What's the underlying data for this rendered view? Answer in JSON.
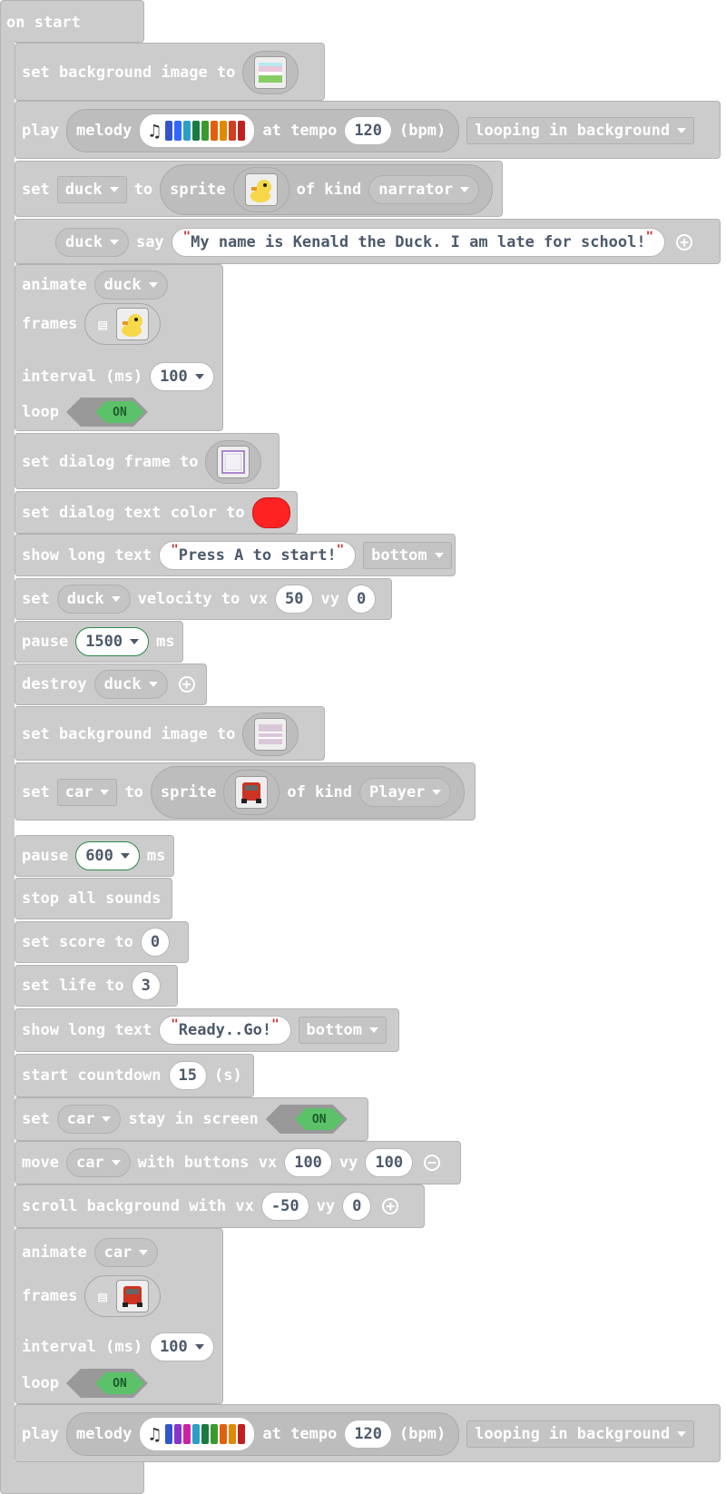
{
  "hat": {
    "label": "on start"
  },
  "blocks": {
    "b1": {
      "t1": "set background image to"
    },
    "b2": {
      "t1": "play",
      "t2": "melody",
      "t3": "at tempo",
      "tempo": "120",
      "t4": "(bpm)",
      "mode": "looping in background",
      "melody_colors": [
        "#3355cc",
        "#3366ff",
        "#2aa0c8",
        "#1a7a40",
        "#3a9a30",
        "#e06010",
        "#e08a00",
        "#d04020",
        "#c02020"
      ]
    },
    "b3": {
      "t1": "set",
      "var": "duck",
      "t2": "to",
      "t3": "sprite",
      "t4": "of kind",
      "kind": "narrator"
    },
    "b4": {
      "var": "duck",
      "t1": "say",
      "text": "My name is Kenald the Duck. I am late for school!"
    },
    "b5": {
      "t1": "animate",
      "var": "duck",
      "t2": "frames",
      "t3": "interval (ms)",
      "interval": "100",
      "t4": "loop",
      "toggle": "ON"
    },
    "b6": {
      "t1": "set dialog frame to"
    },
    "b7": {
      "t1": "set dialog text color to",
      "color": "#ff2222"
    },
    "b8": {
      "t1": "show long text",
      "text": "Press A to start!",
      "pos": "bottom"
    },
    "b9": {
      "t1": "set",
      "var": "duck",
      "t2": "velocity to vx",
      "vx": "50",
      "t3": "vy",
      "vy": "0"
    },
    "b10": {
      "t1": "pause",
      "ms_val": "1500",
      "t2": "ms"
    },
    "b11": {
      "t1": "destroy",
      "var": "duck"
    },
    "b12": {
      "t1": "set background image to"
    },
    "b13": {
      "t1": "set",
      "var": "car",
      "t2": "to",
      "t3": "sprite",
      "t4": "of kind",
      "kind": "Player"
    },
    "b14": {
      "t1": "pause",
      "ms_val": "600",
      "t2": "ms"
    },
    "b15": {
      "t1": "stop all sounds"
    },
    "b16": {
      "t1": "set score to",
      "val": "0"
    },
    "b17": {
      "t1": "set life to",
      "val": "3"
    },
    "b18": {
      "t1": "show long text",
      "text": "Ready..Go!",
      "pos": "bottom"
    },
    "b19": {
      "t1": "start countdown",
      "val": "15",
      "t2": "(s)"
    },
    "b20": {
      "t1": "set",
      "var": "car",
      "t2": "stay in screen",
      "toggle": "ON"
    },
    "b21": {
      "t1": "move",
      "var": "car",
      "t2": "with buttons vx",
      "vx": "100",
      "t3": "vy",
      "vy": "100"
    },
    "b22": {
      "t1": "scroll background with vx",
      "vx": "-50",
      "t2": "vy",
      "vy": "0"
    },
    "b23": {
      "t1": "animate",
      "var": "car",
      "t2": "frames",
      "t3": "interval (ms)",
      "interval": "100",
      "t4": "loop",
      "toggle": "ON"
    },
    "b24": {
      "t1": "play",
      "t2": "melody",
      "t3": "at tempo",
      "tempo": "120",
      "t4": "(bpm)",
      "mode": "looping in background",
      "melody_colors": [
        "#3355cc",
        "#8833cc",
        "#cc22aa",
        "#2aa0c8",
        "#1a7a40",
        "#3a9a30",
        "#e06010",
        "#e08a00",
        "#c02020"
      ]
    }
  },
  "icons": {
    "melody": "music-note-icon",
    "film": "film-strip-icon",
    "plus": "plus-circle-icon",
    "minus": "minus-circle-icon"
  }
}
